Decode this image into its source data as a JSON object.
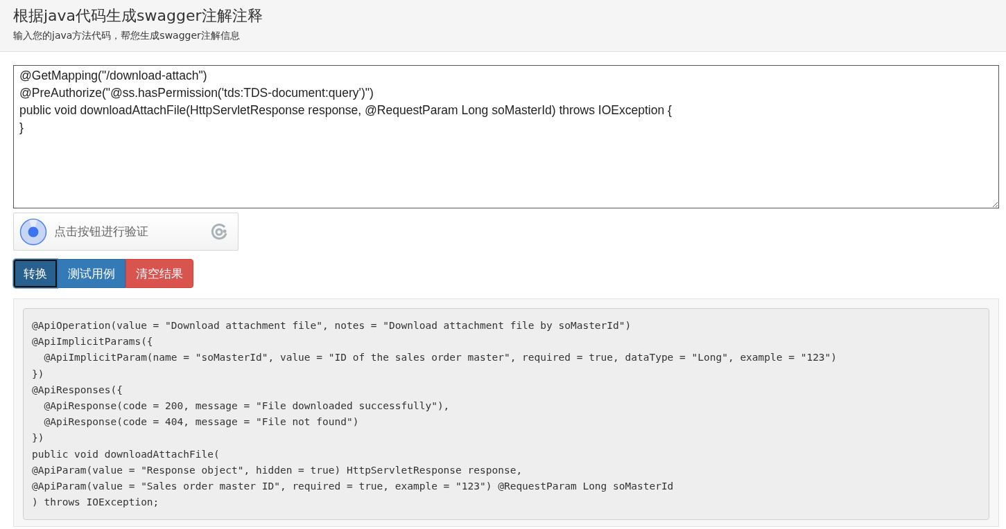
{
  "header": {
    "title": "根据java代码生成swagger注解注释",
    "subtitle": "输入您的java方法代码，帮您生成swagger注解信息"
  },
  "code_input": {
    "lines": [
      "@GetMapping(\"/download-attach\")",
      "@PreAuthorize(\"@ss.hasPermission('tds:TDS-document:query')\")",
      "public void downloadAttachFile(HttpServletResponse response, @RequestParam Long soMasterId) throws IOException {",
      "}"
    ]
  },
  "captcha": {
    "label": "点击按钮进行验证"
  },
  "buttons": [
    {
      "label": "转换",
      "kind": "primary",
      "focused": true
    },
    {
      "label": "测试用例",
      "kind": "primary",
      "focused": false
    },
    {
      "label": "清空结果",
      "kind": "danger",
      "focused": false
    }
  ],
  "result": {
    "lines": [
      "@ApiOperation(value = \"Download attachment file\", notes = \"Download attachment file by soMasterId\")",
      "@ApiImplicitParams({",
      "  @ApiImplicitParam(name = \"soMasterId\", value = \"ID of the sales order master\", required = true, dataType = \"Long\", example = \"123\")",
      "})",
      "@ApiResponses({",
      "  @ApiResponse(code = 200, message = \"File downloaded successfully\"),",
      "  @ApiResponse(code = 404, message = \"File not found\")",
      "})",
      "public void downloadAttachFile(",
      "@ApiParam(value = \"Response object\", hidden = true) HttpServletResponse response,",
      "@ApiParam(value = \"Sales order master ID\", required = true, example = \"123\") @RequestParam Long soMasterId",
      ") throws IOException;"
    ]
  }
}
